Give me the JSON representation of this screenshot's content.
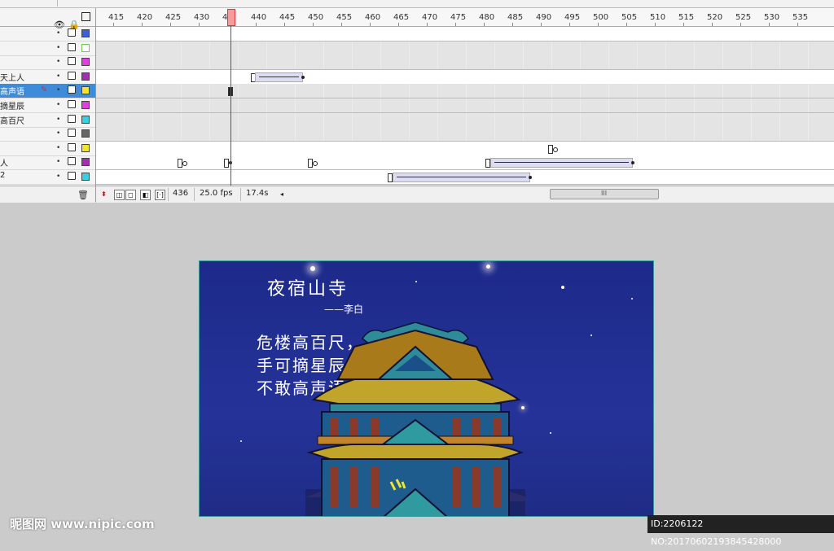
{
  "ruler": {
    "labels": [
      "415",
      "420",
      "425",
      "430",
      "4",
      "440",
      "445",
      "450",
      "455",
      "460",
      "465",
      "470",
      "475",
      "480",
      "485",
      "490",
      "495",
      "500",
      "505",
      "510",
      "515",
      "520",
      "525",
      "530",
      "535"
    ]
  },
  "layers": [
    {
      "name": "",
      "color": "#3a62d8",
      "filled": true
    },
    {
      "name": "",
      "color": "#6ccc4a",
      "filled": false
    },
    {
      "name": "",
      "color": "#e23ee0",
      "filled": true
    },
    {
      "name": "天上人",
      "color": "#a22fb0",
      "filled": true
    },
    {
      "name": "高声语",
      "color": "#f2e52d",
      "filled": true,
      "selected": true
    },
    {
      "name": "摘星辰",
      "color": "#e23ee0",
      "filled": true
    },
    {
      "name": "高百尺",
      "color": "#37d0e0",
      "filled": true
    },
    {
      "name": "",
      "color": "#666666",
      "filled": true
    },
    {
      "name": "",
      "color": "#f2e52d",
      "filled": true
    },
    {
      "name": "人",
      "color": "#a22fb0",
      "filled": true
    },
    {
      "name": "2",
      "color": "#37d0e0",
      "filled": true
    }
  ],
  "status": {
    "frame": "436",
    "fps": "25.0 fps",
    "time": "17.4s",
    "scroll_grip": "III"
  },
  "stage": {
    "title": "夜宿山寺",
    "author": "——李白",
    "lines": [
      "危楼高百尺，",
      "手可摘星辰。",
      "不敢高声语，"
    ]
  },
  "watermark": {
    "left": "昵图网 www.nipic.com",
    "right": "ID:2206122 NO:20170602193845428000"
  }
}
